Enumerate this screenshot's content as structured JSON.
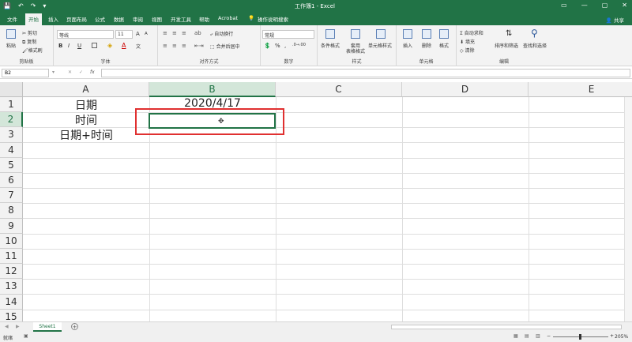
{
  "titlebar": {
    "title": "工作簿1 - Excel",
    "save_icon": "💾",
    "undo_icon": "↶",
    "redo_icon": "↷",
    "customize_icon": "▾",
    "ribbon_options_icon": "▭",
    "minimize_icon": "—",
    "maximize_icon": "▢",
    "close_icon": "✕"
  },
  "tabs": {
    "file": "文件",
    "home": "开始",
    "insert": "插入",
    "layout": "页面布局",
    "formulas": "公式",
    "data": "数据",
    "review": "审阅",
    "view": "视图",
    "developer": "开发工具",
    "help": "帮助",
    "acrobat": "Acrobat",
    "tellme": "操作说明搜索",
    "share": "共享"
  },
  "ribbon": {
    "clipboard": {
      "label": "剪贴板",
      "paste": "粘贴",
      "cut": "剪切",
      "copy": "复制",
      "format_painter": "格式刷"
    },
    "font": {
      "label": "字体",
      "name": "等线",
      "size": "11",
      "bold": "B",
      "italic": "I",
      "underline": "U",
      "grow": "A",
      "shrink": "A",
      "color": "A"
    },
    "alignment": {
      "label": "对齐方式",
      "wrap": "自动换行",
      "merge": "合并后居中"
    },
    "number": {
      "label": "数字",
      "format": "常规",
      "percent": "%",
      "comma": ","
    },
    "styles": {
      "label": "样式",
      "conditional": "条件格式",
      "as_table_1": "套用",
      "as_table_2": "表格格式",
      "cell_styles": "单元格样式"
    },
    "cells": {
      "label": "单元格",
      "insert": "插入",
      "delete": "删除",
      "format": "格式"
    },
    "editing": {
      "label": "编辑",
      "autosum": "自动求和",
      "fill": "填充",
      "clear": "清除",
      "sort": "排序和筛选",
      "find": "查找和选择"
    }
  },
  "formula_bar": {
    "name_box": "B2",
    "cancel": "✕",
    "enter": "✓",
    "fx": "fx",
    "content": ""
  },
  "columns": [
    "A",
    "B",
    "C",
    "D",
    "E"
  ],
  "rows": [
    "1",
    "2",
    "3",
    "4",
    "5",
    "6",
    "7",
    "8",
    "9",
    "10",
    "11",
    "12",
    "13",
    "14",
    "15"
  ],
  "cells": {
    "A1": "日期",
    "A2": "时间",
    "A3": "日期+时间",
    "B1": "2020/4/17"
  },
  "sheets": {
    "active": "Sheet1",
    "add": "+"
  },
  "status": {
    "mode": "就绪",
    "zoom": "205%",
    "zoom_out": "−",
    "zoom_in": "+"
  }
}
